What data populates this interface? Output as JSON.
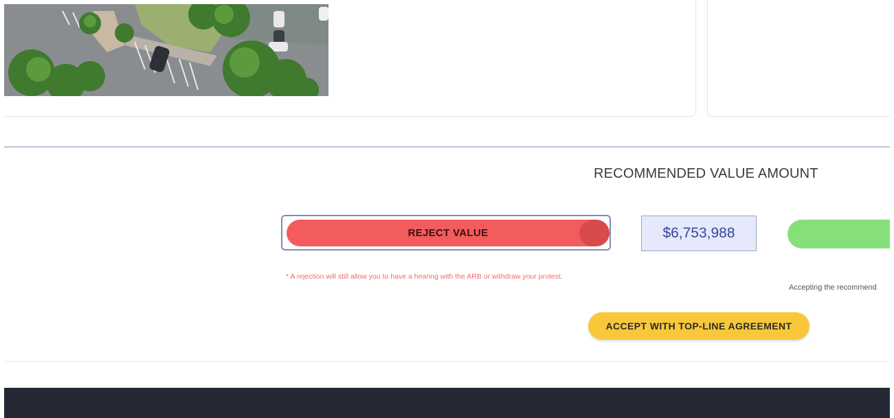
{
  "recommendation": {
    "title": "RECOMMENDED VALUE AMOUNT",
    "value": "$6,753,988"
  },
  "actions": {
    "reject_label": "REJECT VALUE",
    "accept_label": "",
    "topline_label": "ACCEPT WITH TOP-LINE AGREEMENT"
  },
  "notes": {
    "reject_note": "* A rejection will still allow you to have a hearing with the ARB or withdraw your protest.",
    "accept_note": "Accepting the recommend"
  },
  "colors": {
    "reject": "#f25c5c",
    "accept": "#86e07a",
    "topline": "#f8c83a",
    "value_bg": "#e5e9fb",
    "footer": "#252834",
    "divider": "#b9c4d6"
  }
}
